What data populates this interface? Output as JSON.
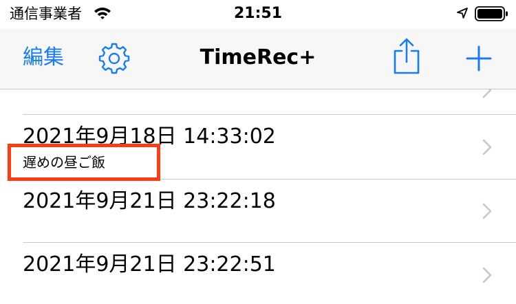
{
  "status_bar": {
    "carrier": "通信事業者",
    "time": "21:51",
    "wifi_icon": "wifi-icon",
    "location_icon": "location-arrow-icon",
    "battery_icon": "battery-full-icon"
  },
  "nav": {
    "edit_label": "編集",
    "title": "TimeRec+",
    "settings_icon": "gear-icon",
    "share_icon": "share-icon",
    "add_icon": "plus-icon"
  },
  "records": [
    {
      "datetime": "2021年9月18日 14:33:02",
      "note": "遅めの昼ご飯"
    },
    {
      "datetime": "2021年9月21日 23:22:18",
      "note": ""
    },
    {
      "datetime": "2021年9月21日 23:22:51",
      "note": ""
    }
  ],
  "colors": {
    "accent": "#1a7cf5",
    "highlight": "#ff3b12",
    "separator": "#c8c7cc",
    "chevron": "#c7c7cc"
  }
}
